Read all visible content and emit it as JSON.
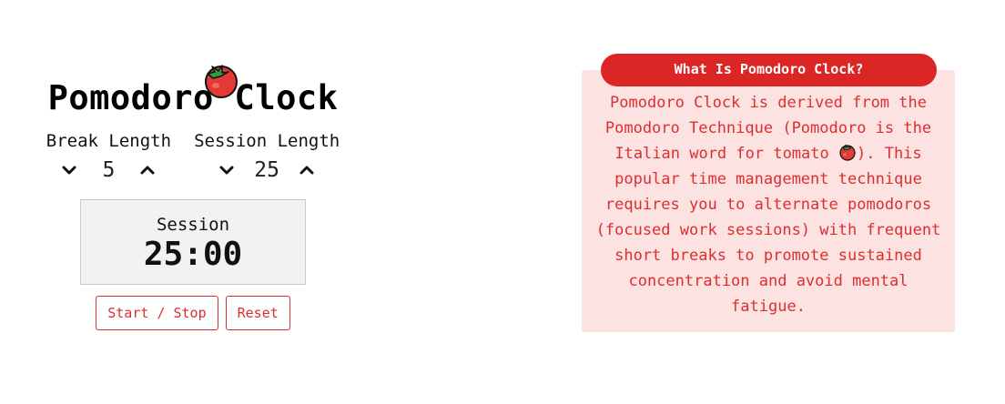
{
  "app": {
    "title": "Pomodoro Clock",
    "title_icon": "tomato-icon",
    "break": {
      "label": "Break Length",
      "value": "5",
      "decrement_icon": "chevron-down-icon",
      "increment_icon": "chevron-up-icon"
    },
    "session": {
      "label": "Session Length",
      "value": "25",
      "decrement_icon": "chevron-down-icon",
      "increment_icon": "chevron-up-icon"
    },
    "timer": {
      "label": "Session",
      "time": "25:00"
    },
    "buttons": {
      "start_stop": "Start / Stop",
      "reset": "Reset"
    }
  },
  "info": {
    "heading": "What Is Pomodoro Clock?",
    "text_before_icon": "Pomodoro Clock is derived from the Pomodoro Technique (Pomodoro is the Italian word for tomato",
    "inline_icon": "tomato-icon",
    "text_after_icon": "). This popular time management technique requires you to alternate pomodoros (focused work sessions) with frequent short breaks to promote sustained concentration and avoid mental fatigue."
  },
  "colors": {
    "accent": "#dc2626",
    "info_background": "#fde2e2",
    "timer_background": "#f1f2f4"
  }
}
